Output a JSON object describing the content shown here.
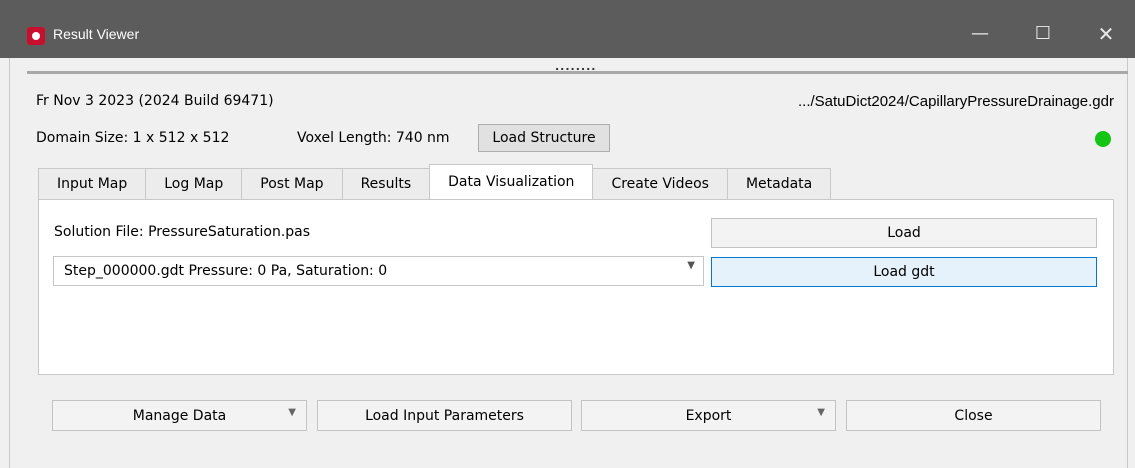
{
  "window": {
    "title": "Result Viewer",
    "minimize_glyph": "—",
    "maximize_glyph": "☐",
    "close_glyph": "✕"
  },
  "splitter": {
    "handle": "........"
  },
  "header": {
    "date_build": "Fr Nov 3 2023 (2024 Build 69471)",
    "file_path": ".../SatuDict2024/CapillaryPressureDrainage.gdr",
    "domain_size": "Domain Size: 1 x 512 x 512",
    "voxel_length": "Voxel Length: 740 nm",
    "load_structure_label": "Load Structure",
    "status_color": "#15c415"
  },
  "tabs": [
    {
      "label": "Input Map",
      "active": false
    },
    {
      "label": "Log Map",
      "active": false
    },
    {
      "label": "Post Map",
      "active": false
    },
    {
      "label": "Results",
      "active": false
    },
    {
      "label": "Data Visualization",
      "active": true
    },
    {
      "label": "Create Videos",
      "active": false
    },
    {
      "label": "Metadata",
      "active": false
    }
  ],
  "data_visualization": {
    "solution_file": "Solution File: PressureSaturation.pas",
    "load_label": "Load",
    "step_selected": "Step_000000.gdt Pressure: 0 Pa, Saturation: 0",
    "load_gdt_label": "Load gdt"
  },
  "footer": {
    "manage_data_label": "Manage Data",
    "load_input_parameters_label": "Load Input Parameters",
    "export_label": "Export",
    "close_label": "Close"
  },
  "icons": {
    "app": "app-logo-icon",
    "dropdown": "chevron-down-icon"
  }
}
